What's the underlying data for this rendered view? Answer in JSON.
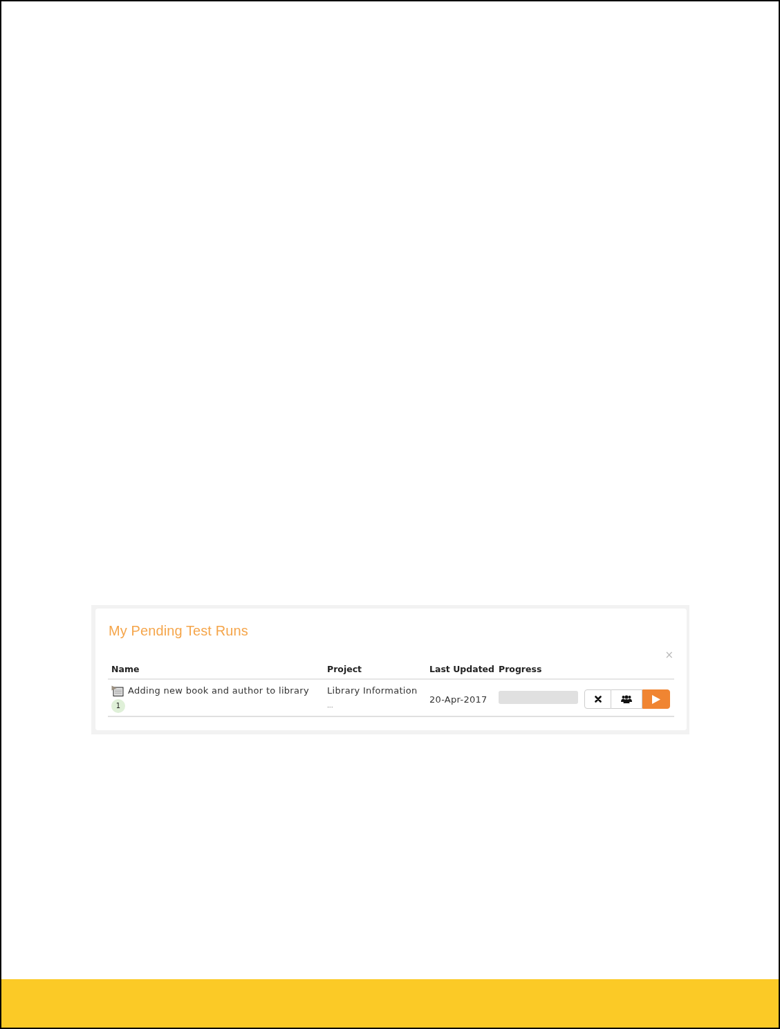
{
  "widget": {
    "title": "My Pending Test Runs",
    "close": "×"
  },
  "table": {
    "columns": [
      "Name",
      "Project",
      "Last Updated",
      "Progress"
    ],
    "rows": [
      {
        "name": "Adding new book and author to library",
        "count": "1",
        "project": "Library Information",
        "project_more": "...",
        "last_updated": "20-Apr-2017",
        "progress": {
          "level": 0
        },
        "actions": [
          {
            "kind": "remove"
          },
          {
            "kind": "assign"
          },
          {
            "kind": "execute"
          }
        ]
      }
    ]
  }
}
